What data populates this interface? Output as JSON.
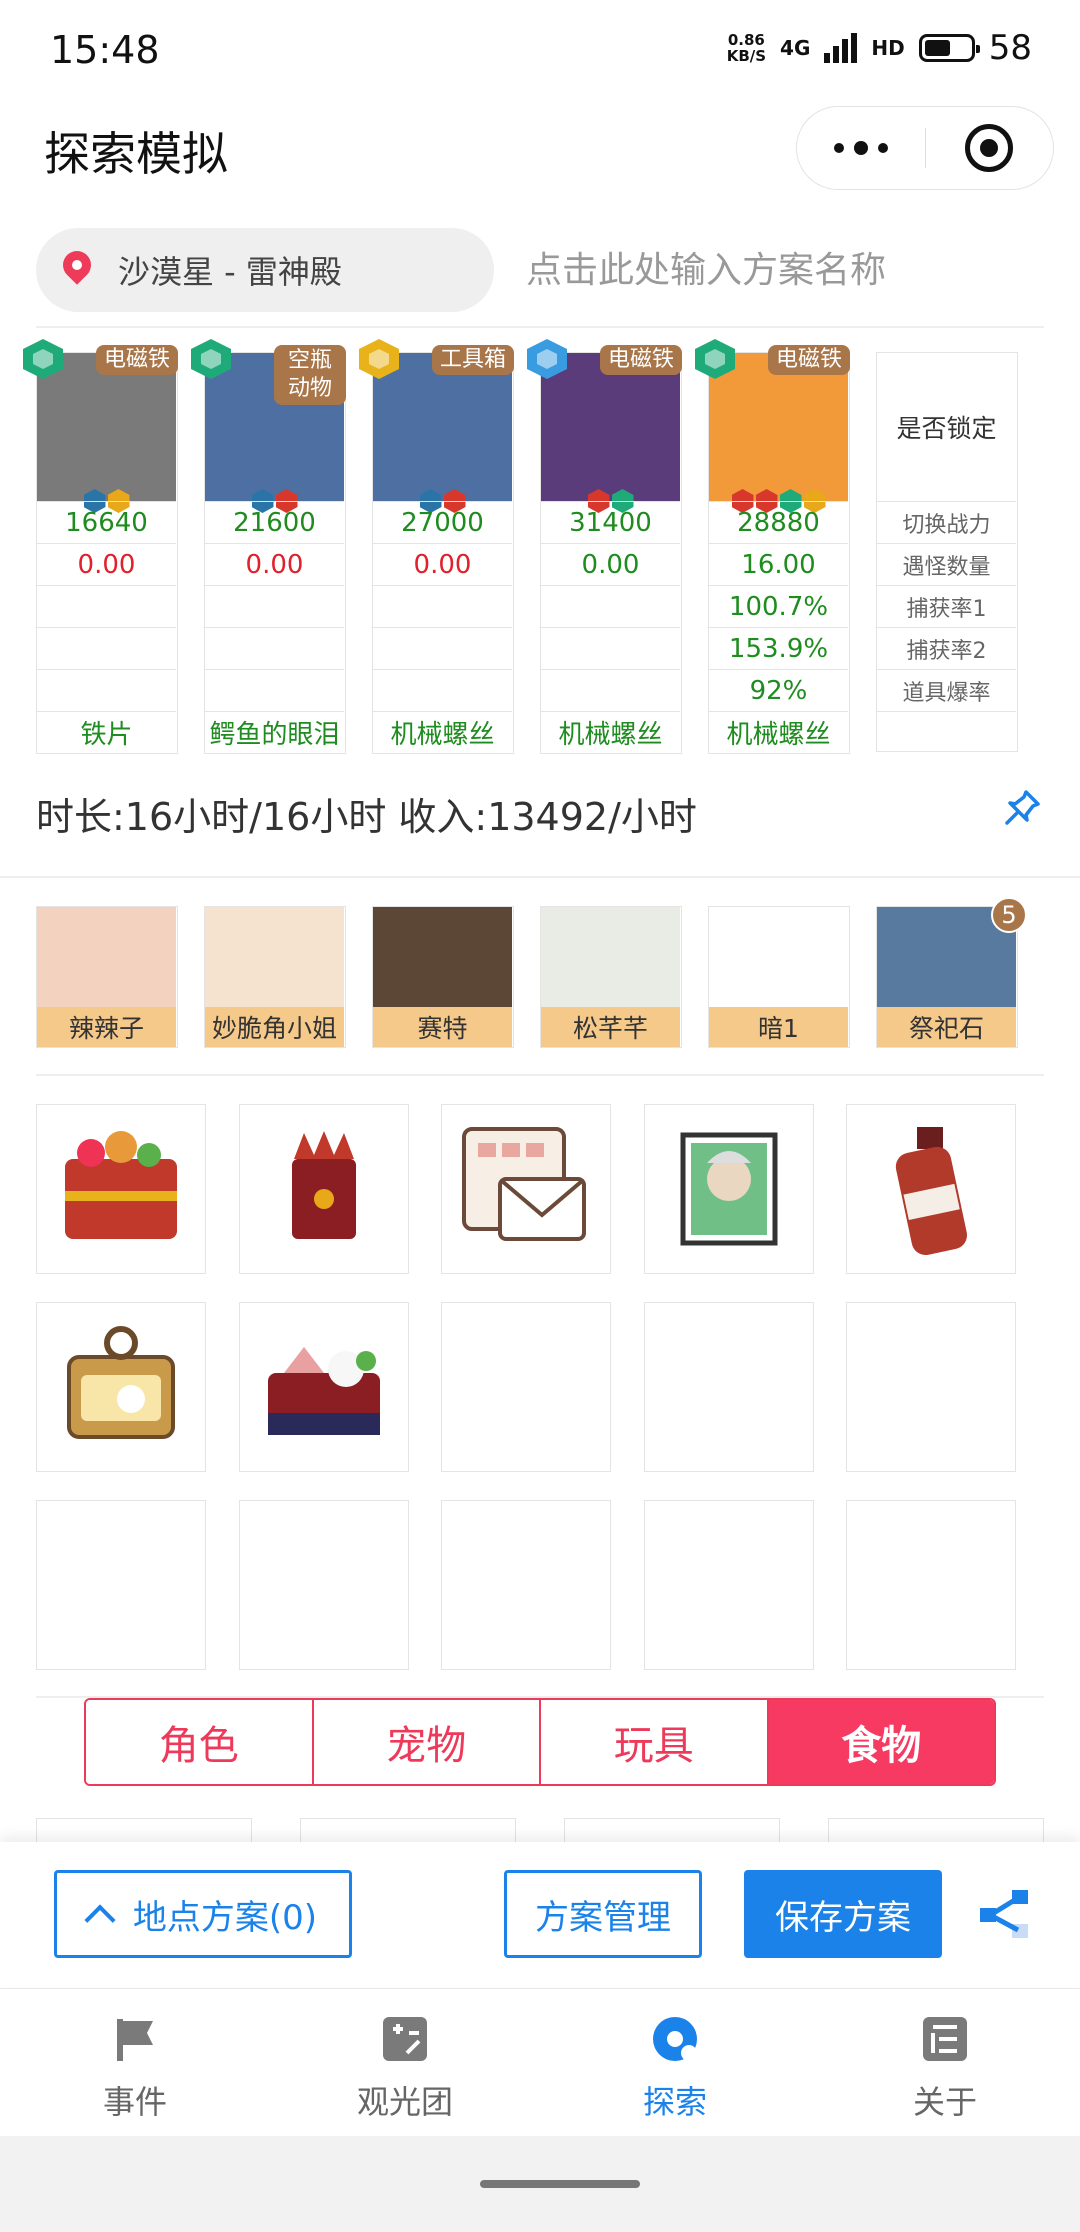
{
  "status_bar": {
    "time": "15:48",
    "speed_value": "0.86",
    "speed_unit": "KB/S",
    "network": "4G",
    "hd": "HD",
    "battery": "58",
    "battery_level": 0.58
  },
  "nav": {
    "title": "探索模拟"
  },
  "location": {
    "name": "沙漠星 - 雷神殿",
    "plan_placeholder": "点击此处输入方案名称"
  },
  "pets": [
    {
      "tag": "电磁铁",
      "rarity": "green",
      "power": "16640",
      "monster_count": "0.00",
      "capture1": "",
      "capture2": "",
      "drop_rate": "",
      "item": "铁片",
      "count_color": "red",
      "elements": [
        "blue",
        "gold"
      ]
    },
    {
      "tag": "空瓶动物",
      "rarity": "green",
      "power": "21600",
      "monster_count": "0.00",
      "capture1": "",
      "capture2": "",
      "drop_rate": "",
      "item": "鳄鱼的眼泪",
      "count_color": "red",
      "elements": [
        "blue",
        "red"
      ]
    },
    {
      "tag": "工具箱",
      "rarity": "gold",
      "power": "27000",
      "monster_count": "0.00",
      "capture1": "",
      "capture2": "",
      "drop_rate": "",
      "item": "机械螺丝",
      "count_color": "red",
      "elements": [
        "blue",
        "red"
      ]
    },
    {
      "tag": "电磁铁",
      "rarity": "blue",
      "power": "31400",
      "monster_count": "0.00",
      "capture1": "",
      "capture2": "",
      "drop_rate": "",
      "item": "机械螺丝",
      "count_color": "green",
      "elements": [
        "red",
        "green"
      ]
    },
    {
      "tag": "电磁铁",
      "rarity": "green",
      "power": "28880",
      "monster_count": "16.00",
      "capture1": "100.7%",
      "capture2": "153.9%",
      "drop_rate": "92%",
      "item": "机械螺丝",
      "count_color": "green",
      "elements": [
        "red",
        "red",
        "green",
        "gold"
      ]
    }
  ],
  "lock_column": {
    "header": "是否锁定",
    "rows": [
      "切换战力",
      "遇怪数量",
      "捕获率1",
      "捕获率2",
      "道具爆率"
    ]
  },
  "summary": "时长:16小时/16小时 收入:13492/小时",
  "roles": [
    {
      "name": "辣辣子",
      "badge": ""
    },
    {
      "name": "妙脆角小姐",
      "badge": ""
    },
    {
      "name": "赛特",
      "badge": ""
    },
    {
      "name": "松芊芊",
      "badge": ""
    },
    {
      "name": "暗1",
      "badge": ""
    },
    {
      "name": "祭祀石",
      "badge": "5"
    }
  ],
  "food_icons": [
    "bento-box-icon",
    "spice-bag-icon",
    "letter-icon",
    "portrait-frame-icon",
    "sauce-bottle-icon",
    "cat-snack-can-icon",
    "sushi-box-icon"
  ],
  "tabs": [
    "角色",
    "宠物",
    "玩具",
    "食物"
  ],
  "active_tab": 3,
  "actions": {
    "location_plans": "地点方案(0)",
    "manage": "方案管理",
    "save": "保存方案"
  },
  "tabbar": [
    {
      "label": "事件",
      "icon": "flag-icon"
    },
    {
      "label": "观光团",
      "icon": "calculator-icon"
    },
    {
      "label": "探索",
      "icon": "explore-icon"
    },
    {
      "label": "关于",
      "icon": "list-icon"
    }
  ],
  "active_tabbar": 2,
  "colors": {
    "accent_blue": "#1b82ea",
    "tab_pink": "#f63a62",
    "green_text": "#1f8c1f",
    "red_text": "#e0202a",
    "tag_brown": "#a9764a",
    "role_label_bg": "#f5c98a"
  }
}
